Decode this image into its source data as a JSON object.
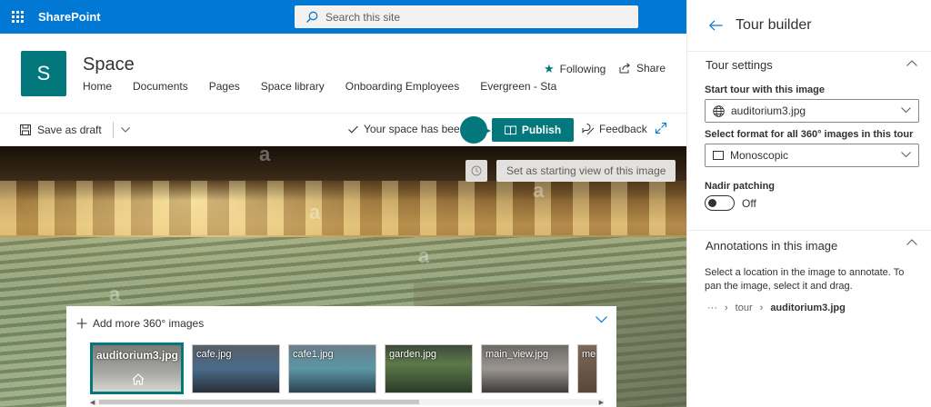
{
  "suite": {
    "brand": "SharePoint",
    "search_placeholder": "Search this site"
  },
  "site": {
    "logo_letter": "S",
    "title": "Space",
    "nav": [
      "Home",
      "Documents",
      "Pages",
      "Space library",
      "Onboarding Employees",
      "Evergreen - Sta"
    ],
    "following_label": "Following",
    "share_label": "Share"
  },
  "commandbar": {
    "save_draft_label": "Save as draft",
    "status_text": "Your space has been",
    "publish_label": "Publish",
    "feedback_label": "Feedback"
  },
  "viewer": {
    "start_view_label": "Set as starting view of this image",
    "watermark": "a"
  },
  "strip": {
    "add_more_label": "Add more 360° images",
    "thumbnails": [
      {
        "name": "auditorium3.jpg",
        "selected": true
      },
      {
        "name": "cafe.jpg"
      },
      {
        "name": "cafe1.jpg"
      },
      {
        "name": "garden.jpg"
      },
      {
        "name": "main_view.jpg"
      },
      {
        "name": "me"
      }
    ]
  },
  "pane": {
    "title": "Tour builder",
    "settings": {
      "heading": "Tour settings",
      "start_label": "Start tour with this image",
      "start_value": "auditorium3.jpg",
      "format_label": "Select format for all 360° images in this tour",
      "format_value": "Monoscopic",
      "nadir_label": "Nadir patching",
      "nadir_state": "Off"
    },
    "annotations": {
      "heading": "Annotations in this image",
      "instructions": "Select a location in the image to annotate. To pan the image, select it and drag.",
      "breadcrumb": {
        "ellipsis": "···",
        "parent": "tour",
        "current": "auditorium3.jpg"
      }
    }
  },
  "colors": {
    "suite_blue": "#0078d4",
    "accent_teal": "#03787c"
  }
}
